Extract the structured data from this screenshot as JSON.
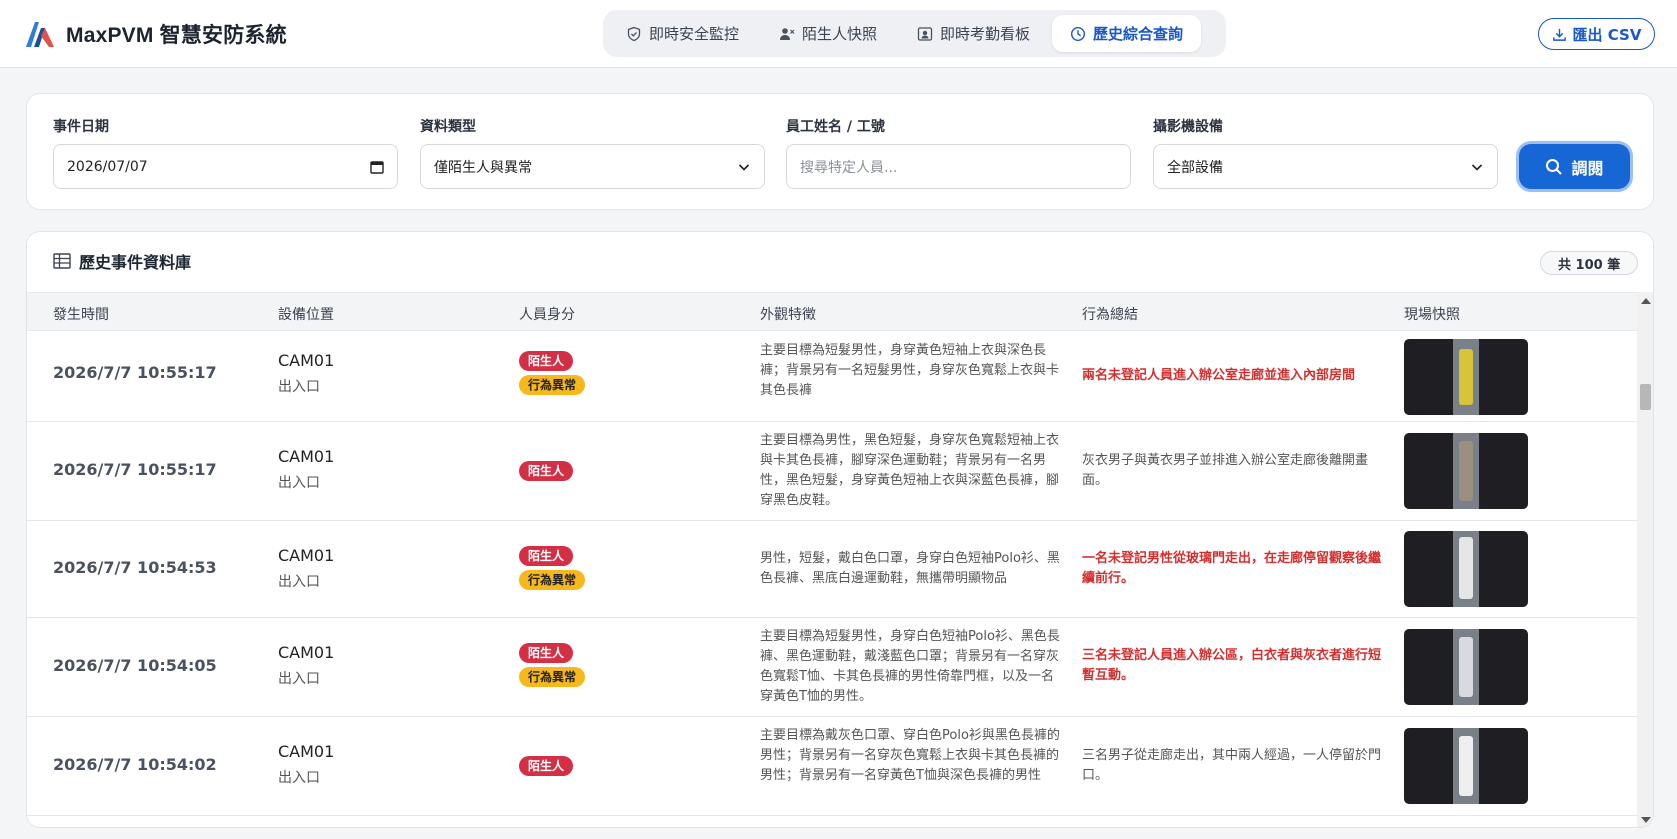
{
  "app": {
    "name": "MaxPVM 智慧安防系統"
  },
  "nav": {
    "tabs": [
      {
        "label": "即時安全監控",
        "icon": "shield-icon",
        "active": false
      },
      {
        "label": "陌生人快照",
        "icon": "user-x-icon",
        "active": false
      },
      {
        "label": "即時考勤看板",
        "icon": "id-card-icon",
        "active": false
      },
      {
        "label": "歷史綜合查詢",
        "icon": "clock-icon",
        "active": true
      }
    ]
  },
  "export": {
    "label": "匯出 CSV",
    "icon": "download-icon"
  },
  "filters": {
    "date": {
      "label": "事件日期",
      "value": "2026/07/07"
    },
    "type": {
      "label": "資料類型",
      "value": "僅陌生人與異常"
    },
    "employee": {
      "label": "員工姓名 / 工號",
      "placeholder": "搜尋特定人員..."
    },
    "camera": {
      "label": "攝影機設備",
      "value": "全部設備"
    },
    "search_label": "調閱"
  },
  "table": {
    "title": "歷史事件資料庫",
    "count": "共 100 筆",
    "columns": [
      "發生時間",
      "設備位置",
      "人員身分",
      "外觀特徵",
      "行為總結",
      "現場快照"
    ],
    "rows": [
      {
        "time": "2026/7/7 10:55:17",
        "device": "CAM01",
        "location": "出入口",
        "badges": [
          "陌生人",
          "行為異常"
        ],
        "appearance": "主要目標為短髮男性，身穿黃色短袖上衣與深色長褲；背景另有一名短髮男性，身穿灰色寬鬆上衣與卡其色長褲",
        "summary": "兩名未登記人員進入辦公室走廊並進入內部房間",
        "alert": true
      },
      {
        "time": "2026/7/7 10:55:17",
        "device": "CAM01",
        "location": "出入口",
        "badges": [
          "陌生人"
        ],
        "appearance": "主要目標為男性，黑色短髮，身穿灰色寬鬆短袖上衣與卡其色長褲，腳穿深色運動鞋；背景另有一名男性，黑色短髮，身穿黃色短袖上衣與深藍色長褲，腳穿黑色皮鞋。",
        "summary": "灰衣男子與黃衣男子並排進入辦公室走廊後離開畫面。",
        "alert": false
      },
      {
        "time": "2026/7/7 10:54:53",
        "device": "CAM01",
        "location": "出入口",
        "badges": [
          "陌生人",
          "行為異常"
        ],
        "appearance": "男性，短髮，戴白色口罩，身穿白色短袖Polo衫、黑色長褲、黑底白邊運動鞋，無攜帶明顯物品",
        "summary": "一名未登記男性從玻璃門走出，在走廊停留觀察後繼續前行。",
        "alert": true
      },
      {
        "time": "2026/7/7 10:54:05",
        "device": "CAM01",
        "location": "出入口",
        "badges": [
          "陌生人",
          "行為異常"
        ],
        "appearance": "主要目標為短髮男性，身穿白色短袖Polo衫、黑色長褲、黑色運動鞋，戴淺藍色口罩；背景另有一名穿灰色寬鬆T恤、卡其色長褲的男性倚靠門框，以及一名穿黃色T恤的男性。",
        "summary": "三名未登記人員進入辦公區，白衣者與灰衣者進行短暫互動。",
        "alert": true
      },
      {
        "time": "2026/7/7 10:54:02",
        "device": "CAM01",
        "location": "出入口",
        "badges": [
          "陌生人"
        ],
        "appearance": "主要目標為戴灰色口罩、穿白色Polo衫與黑色長褲的男性；背景另有一名穿灰色寬鬆上衣與卡其色長褲的男性；背景另有一名穿黃色T恤與深色長褲的男性",
        "summary": "三名男子從走廊走出，其中兩人經過，一人停留於門口。",
        "alert": false
      }
    ]
  },
  "colors": {
    "accent": "#1766d6",
    "danger": "#d32f45",
    "warning": "#f6b81c"
  }
}
